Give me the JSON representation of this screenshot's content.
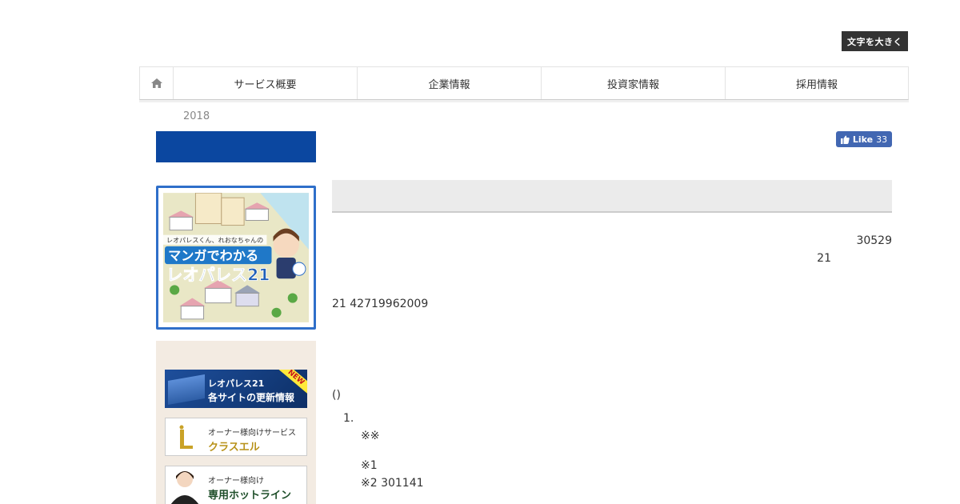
{
  "header": {
    "font_size_button": "文字を大きく"
  },
  "nav": {
    "home_icon": "home-icon",
    "items": [
      "サービス概要",
      "企業情報",
      "投資家情報",
      "採用情報"
    ]
  },
  "breadcrumb": {
    "year": "2018"
  },
  "social": {
    "like_label": "Like",
    "like_count": "33"
  },
  "sidebar": {
    "manga_banner": {
      "line1": "レオパレスくん、れおなちゃんの",
      "line2": "マンガでわかる",
      "line3": "レオパレス21"
    },
    "banners": [
      {
        "line1": "レオパレス21",
        "line2": "各サイトの更新情報",
        "badge": "NEW"
      },
      {
        "line1": "オーナー様向けサービス",
        "line2": "クラスエル"
      },
      {
        "line1": "オーナー様向け",
        "line2": "専用ホットライン"
      }
    ]
  },
  "article": {
    "right_line1": "30529",
    "right_line2": "21",
    "line_a": "21 42719962009",
    "line_b": "()",
    "list_number": "1.",
    "note1": "※※",
    "note2": "※1",
    "note3": "※2 301141"
  },
  "colors": {
    "accent_blue": "#0b47a0",
    "banner_border": "#2f6fc9",
    "sidebar_bg": "#f3ebe2",
    "fb_blue": "#4267b2"
  }
}
